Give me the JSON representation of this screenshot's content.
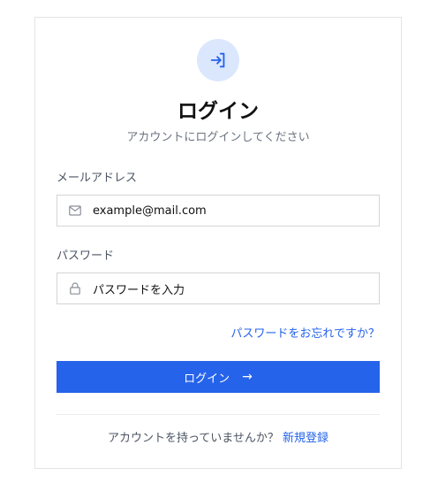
{
  "header": {
    "icon": "login-icon",
    "title": "ログイン",
    "subtitle": "アカウントにログインしてください"
  },
  "email": {
    "label": "メールアドレス",
    "icon": "mail-icon",
    "value": "example@mail.com"
  },
  "password": {
    "label": "パスワード",
    "icon": "lock-icon",
    "placeholder": "パスワードを入力"
  },
  "forgot_link": "パスワードをお忘れですか？",
  "login_button": {
    "label": "ログイン",
    "arrow": "→"
  },
  "footer": {
    "text": "アカウントを持っていませんか？",
    "signup_link": "新規登録"
  },
  "colors": {
    "accent": "#2563eb",
    "icon_bg": "#dbe7fd"
  }
}
